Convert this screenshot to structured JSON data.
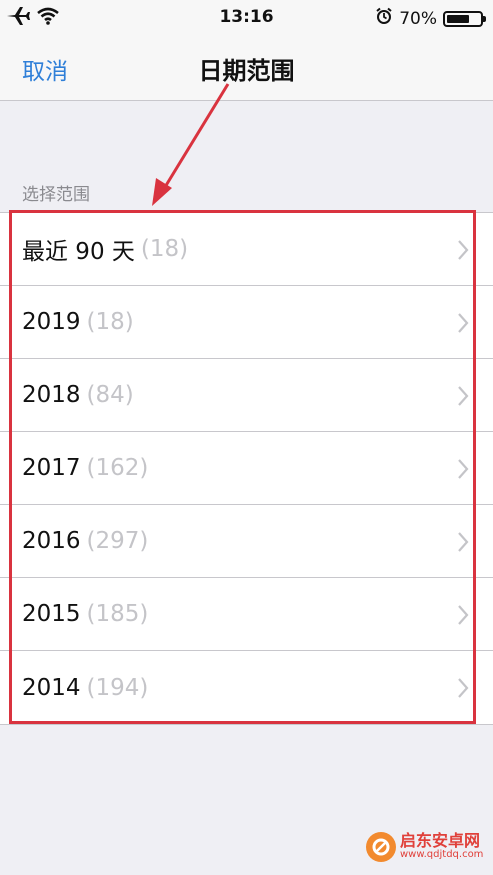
{
  "status_bar": {
    "time": "13:16",
    "battery": "70%",
    "battery_level": 0.7
  },
  "nav": {
    "cancel_label": "取消",
    "title": "日期范围"
  },
  "section": {
    "header": "选择范围"
  },
  "rows": [
    {
      "label": "最近 90 天",
      "count": "(18)"
    },
    {
      "label": "2019",
      "count": "(18)"
    },
    {
      "label": "2018",
      "count": "(84)"
    },
    {
      "label": "2017",
      "count": "(162)"
    },
    {
      "label": "2016",
      "count": "(297)"
    },
    {
      "label": "2015",
      "count": "(185)"
    },
    {
      "label": "2014",
      "count": "(194)"
    }
  ],
  "watermark": {
    "name": "启东安卓网",
    "url": "www.qdjtdq.com"
  },
  "colors": {
    "accent": "#2f7fd8",
    "annotation": "#d9333f",
    "count_gray": "#c4c4c8"
  }
}
